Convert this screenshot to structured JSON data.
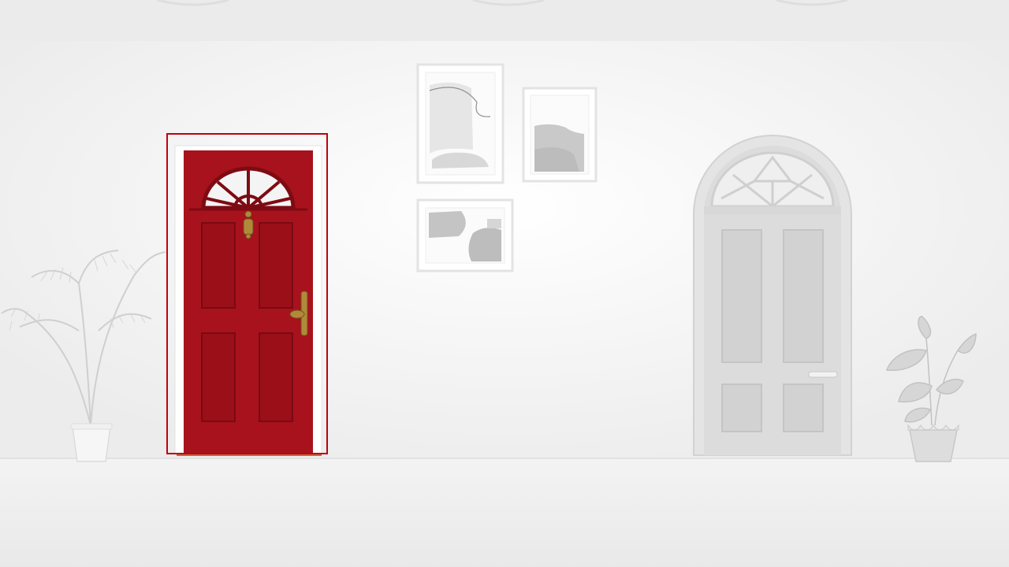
{
  "scene": {
    "wall_color": "#f7f7f7",
    "floor_color": "#eeeeee",
    "ceiling_band_color": "#eaeaea",
    "featured_door": {
      "color": "#a8121c",
      "panel_color": "#9a0f18",
      "hardware_color": "#b08a3a",
      "selected": true,
      "selection_color": "#c0000f"
    },
    "grey_door_color": "#dcdcdc",
    "frame_color": "#ffffff",
    "art_shape_color": "#c8c8c8",
    "plant_color": "#d0d0d0",
    "icons": [
      "potted-palm-icon",
      "potted-plant-icon",
      "ceiling-light-icon",
      "picture-frame-icon"
    ]
  }
}
